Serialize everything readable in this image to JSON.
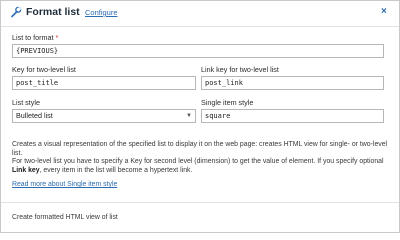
{
  "header": {
    "title": "Format list",
    "configure_label": "Configure",
    "close_label": "×",
    "icon": "wrench-icon",
    "accent": "#2b6cb0"
  },
  "fields": {
    "list_to_format": {
      "label": "List to format",
      "required_mark": "*",
      "value": "{PREVIOUS}"
    },
    "key_two_level": {
      "label": "Key for two-level list",
      "value": "post_title"
    },
    "link_key_two_level": {
      "label": "Link key for two-level list",
      "value": "post_link"
    },
    "list_style": {
      "label": "List style",
      "value": "Bulleted list"
    },
    "single_item_style": {
      "label": "Single item style",
      "value": "square"
    }
  },
  "description": {
    "p1": "Creates a visual representation of the specified list to display it on the web page: creates HTML view for single- or two-level list.",
    "p2_start": "For two-level list you have to specify a Key for second level (dimension) to get the value of element. If you specify optional ",
    "p2_bold": "Link key",
    "p2_end": ", every item in the list will become a hypertext link.",
    "read_more": "Read more about Single item style"
  },
  "footer": {
    "text": "Create formatted HTML view of list"
  }
}
